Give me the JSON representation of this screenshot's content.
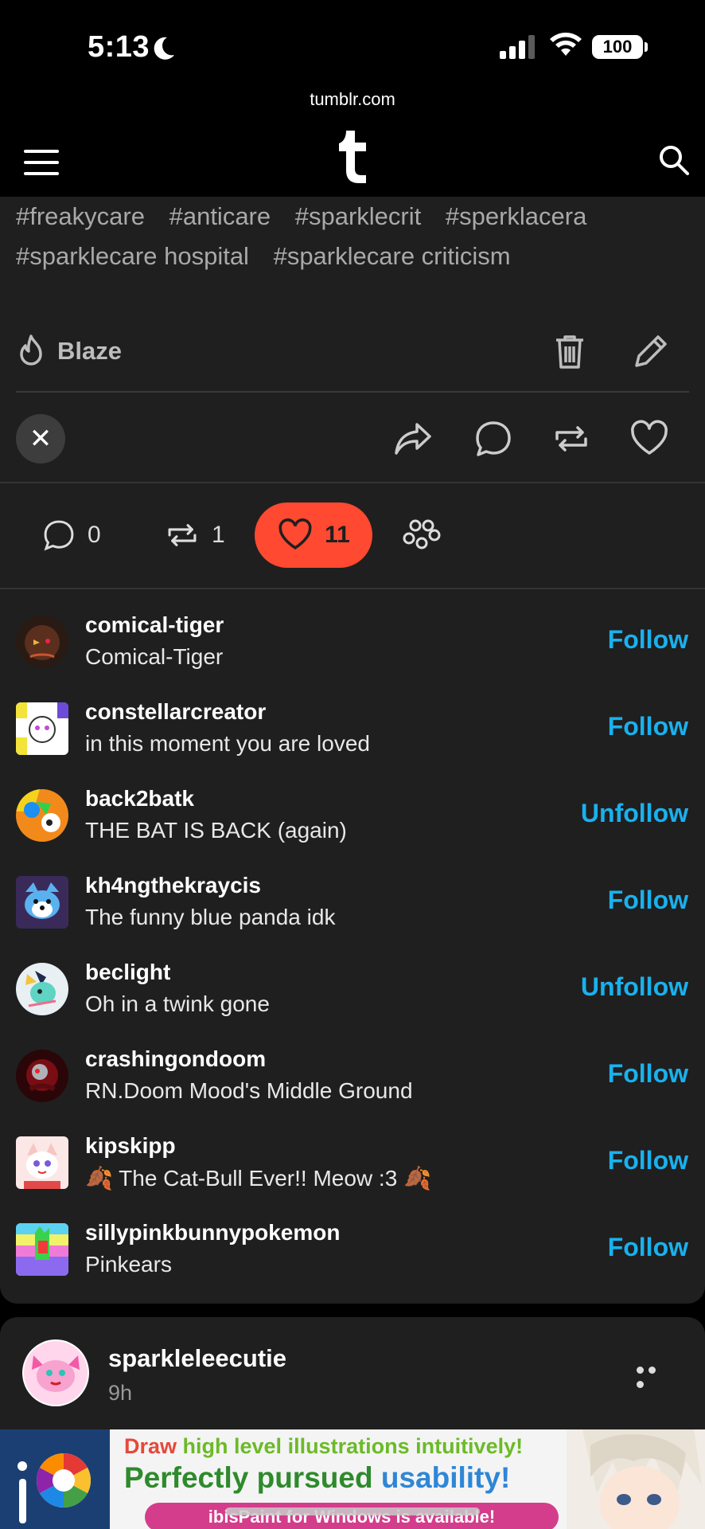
{
  "status_bar": {
    "time": "5:13",
    "battery": "100",
    "url": "tumblr.com"
  },
  "post": {
    "tags": [
      "#freakycare",
      "#anticare",
      "#sparklecrit",
      "#sperklacera",
      "#sparklecare hospital",
      "#sparklecare criticism"
    ],
    "blaze_label": "Blaze"
  },
  "notes": {
    "replies_count": "0",
    "reblogs_count": "1",
    "likes_count": "11"
  },
  "likers": [
    {
      "name": "comical-tiger",
      "title": "Comical-Tiger",
      "action": "Follow"
    },
    {
      "name": "constellarcreator",
      "title": "in this moment you are loved",
      "action": "Follow"
    },
    {
      "name": "back2batk",
      "title": "THE BAT IS BACK (again)",
      "action": "Unfollow"
    },
    {
      "name": "kh4ngthekraycis",
      "title": "The funny blue panda idk",
      "action": "Follow"
    },
    {
      "name": "beclight",
      "title": "Oh in a twink gone",
      "action": "Unfollow"
    },
    {
      "name": "crashingondoom",
      "title": "RN.Doom Mood's Middle Ground",
      "action": "Follow"
    },
    {
      "name": "kipskipp",
      "title": "🍂 The Cat-Bull Ever!! Meow :3 🍂",
      "action": "Follow"
    },
    {
      "name": "sillypinkbunnypokemon",
      "title": "Pinkears",
      "action": "Follow"
    }
  ],
  "next_post": {
    "name": "sparkleleecutie",
    "time": "9h"
  },
  "ad": {
    "line1_a": "Draw ",
    "line1_b": "high level illustrations intuitively!",
    "line2_a": "Perfectly pursued ",
    "line2_b": "usability!",
    "line3": "ibisPaint for Windows is available!"
  },
  "colors": {
    "accent_blue": "#19b1ee",
    "like_red": "#ff4930",
    "card_bg": "#1f1f1f"
  }
}
